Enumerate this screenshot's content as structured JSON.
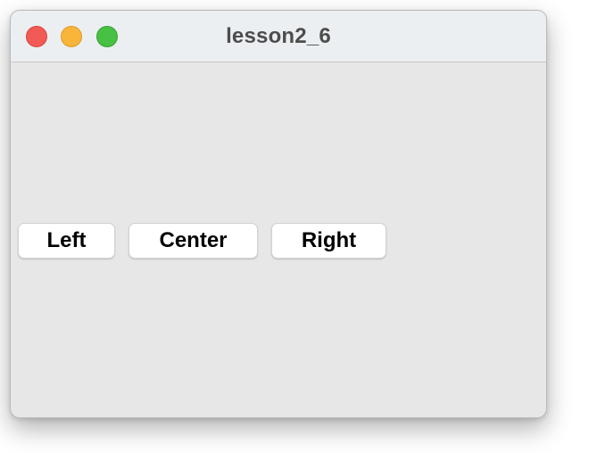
{
  "window": {
    "title": "lesson2_6",
    "controls": {
      "close_color": "#f25b55",
      "minimize_color": "#f8b539",
      "zoom_color": "#47c043"
    }
  },
  "buttons": {
    "left_label": "Left",
    "center_label": "Center",
    "right_label": "Right"
  }
}
